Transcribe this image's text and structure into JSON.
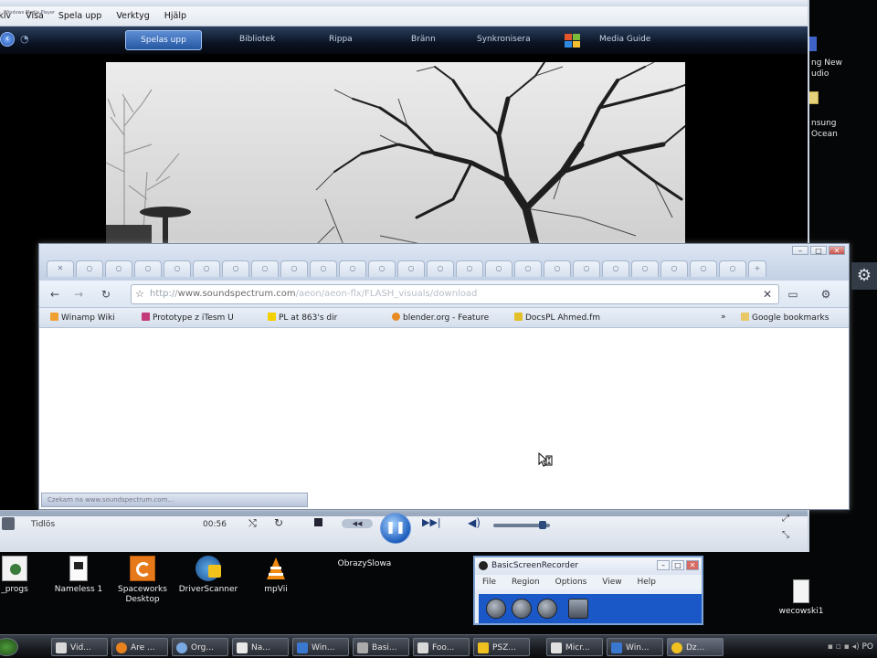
{
  "wmp": {
    "title": "Windows Media Player",
    "menu": [
      "Arkiv",
      "Visa",
      "Spela upp",
      "Verktyg",
      "Hjälp"
    ],
    "tabs": [
      "Spelas upp",
      "Bibliotek",
      "Rippa",
      "Bränn",
      "Synkronisera",
      "Media Guide"
    ],
    "status_text": "Tidlös",
    "time": "00:56"
  },
  "browser": {
    "url_scheme": "http://",
    "url_host": "www.soundspectrum.com",
    "url_path": "/aeon/aeon-flx/FLASH_visuals/download",
    "bookmarks": [
      "Winamp Wiki",
      "Prototype z iTesm U",
      "PL at 863's dir",
      "blender.org - Feature",
      "DocsPL Ahmed.fm",
      "Google bookmarks"
    ],
    "status": "Czekam na www.soundspectrum.com..."
  },
  "desktop": {
    "right_labels": [
      "ng New",
      "udio",
      "nsung",
      "Ocean"
    ],
    "icons": [
      {
        "label": "_progs"
      },
      {
        "label": "Nameless 1"
      },
      {
        "label": "Spaceworks Desktop"
      },
      {
        "label": "DriverScanner"
      },
      {
        "label": "mpVii"
      },
      {
        "label": "ObrazySlowa"
      },
      {
        "label": "wecowski1"
      }
    ]
  },
  "recorder": {
    "title": "BasicScreenRecorder",
    "menu": [
      "File",
      "Region",
      "Options",
      "View",
      "Help"
    ]
  },
  "taskbar": {
    "items": [
      "Vid...",
      "Are ...",
      "Org...",
      "Na...",
      "Win...",
      "Basi...",
      "Foo...",
      "PSZ...",
      "Micr...",
      "Win...",
      "Dz..."
    ],
    "clock": "PO"
  }
}
